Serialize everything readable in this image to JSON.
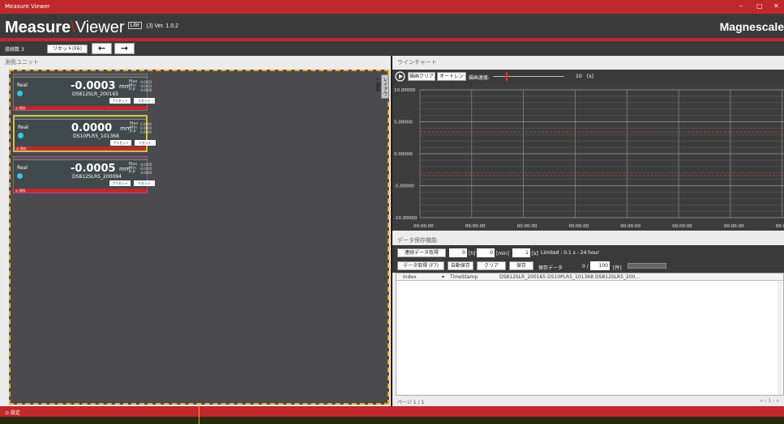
{
  "window": {
    "title": "Measure Viewer",
    "controls": [
      "–",
      "▢",
      "✕"
    ]
  },
  "header": {
    "logo_bold": "Measure",
    "logo_light": "Viewer",
    "lite": "Lite",
    "version": "(J) Ver. 1.0.2",
    "brand": "Magnescale"
  },
  "toolbar": {
    "count_label": "接続数 3",
    "reset_label": "リセット(F6)",
    "back": "←",
    "forward": "→"
  },
  "left": {
    "title": "測長ユニット",
    "side_tab": "レイアウト編集"
  },
  "units": [
    {
      "mode": "Real",
      "value": "-0.0003",
      "unit": "mm",
      "stats_labels": "Max\nMin\nP-P",
      "stats_values": "-0.0003\n-0.0003\n0.0000",
      "name": "DS812SLR_200165",
      "preset": "プリセット",
      "reset": "リセット",
      "bar": "◎ 保存"
    },
    {
      "mode": "Real",
      "value": "0.0000",
      "unit": "mm",
      "stats_labels": "Max\nMin\nP-P",
      "stats_values": "0.0000\n0.0000\n0.0000",
      "name": "DS10PLR5_101368",
      "preset": "プリセット",
      "reset": "リセット",
      "bar": "◎ 保存"
    },
    {
      "mode": "Real",
      "value": "-0.0005",
      "unit": "mm",
      "stats_labels": "Max\nMin\nP-P",
      "stats_values": "-0.0005\n-0.0005\n0.0000",
      "name": "DS812SLR5_200094",
      "preset": "プリセット",
      "reset": "リセット",
      "bar": "◎ 保存"
    }
  ],
  "chart": {
    "title": "ラインチャート",
    "clear_btn": "描画クリア",
    "autorange_btn": "オートレンジ",
    "speed_label": "描画速度:",
    "speed_value": "10",
    "speed_unit": "[s]",
    "y_labels": [
      "10.00000",
      "5.00000",
      "0.00000",
      "-5.00000",
      "-10.00000"
    ],
    "x_labels": [
      "00:00:00",
      "00:00:00",
      "00:00:00",
      "00:00:00",
      "00:00:00",
      "00:00:00",
      "00:00:00",
      "00:00:00"
    ]
  },
  "data": {
    "title": "データ保存機能",
    "continuous_btn": "連続データ取得",
    "h_value": "0",
    "h_unit": "[h]",
    "min_value": "0",
    "min_unit": "[min]",
    "s_value": "1",
    "s_unit": "[s]",
    "limited": "Limited : 0.1 s - 24 hour",
    "acquire_btn": "データ取得 (F7)",
    "autosave_btn": "自動保存",
    "clear_btn": "クリア",
    "save_btn": "保存",
    "saved_label": "保存データ",
    "saved_count": "0 /",
    "saved_max": "100",
    "saved_unit": "[件]",
    "columns": [
      "Index",
      "TimeStamp",
      "DS812SLR_200165",
      "DS10PLR5_101368",
      "DS812SLR5_200..."
    ],
    "page_label": "ページ 1 / 1",
    "pager": "« ‹ 1 › »"
  },
  "settings": {
    "label": "⊙ 設定"
  }
}
